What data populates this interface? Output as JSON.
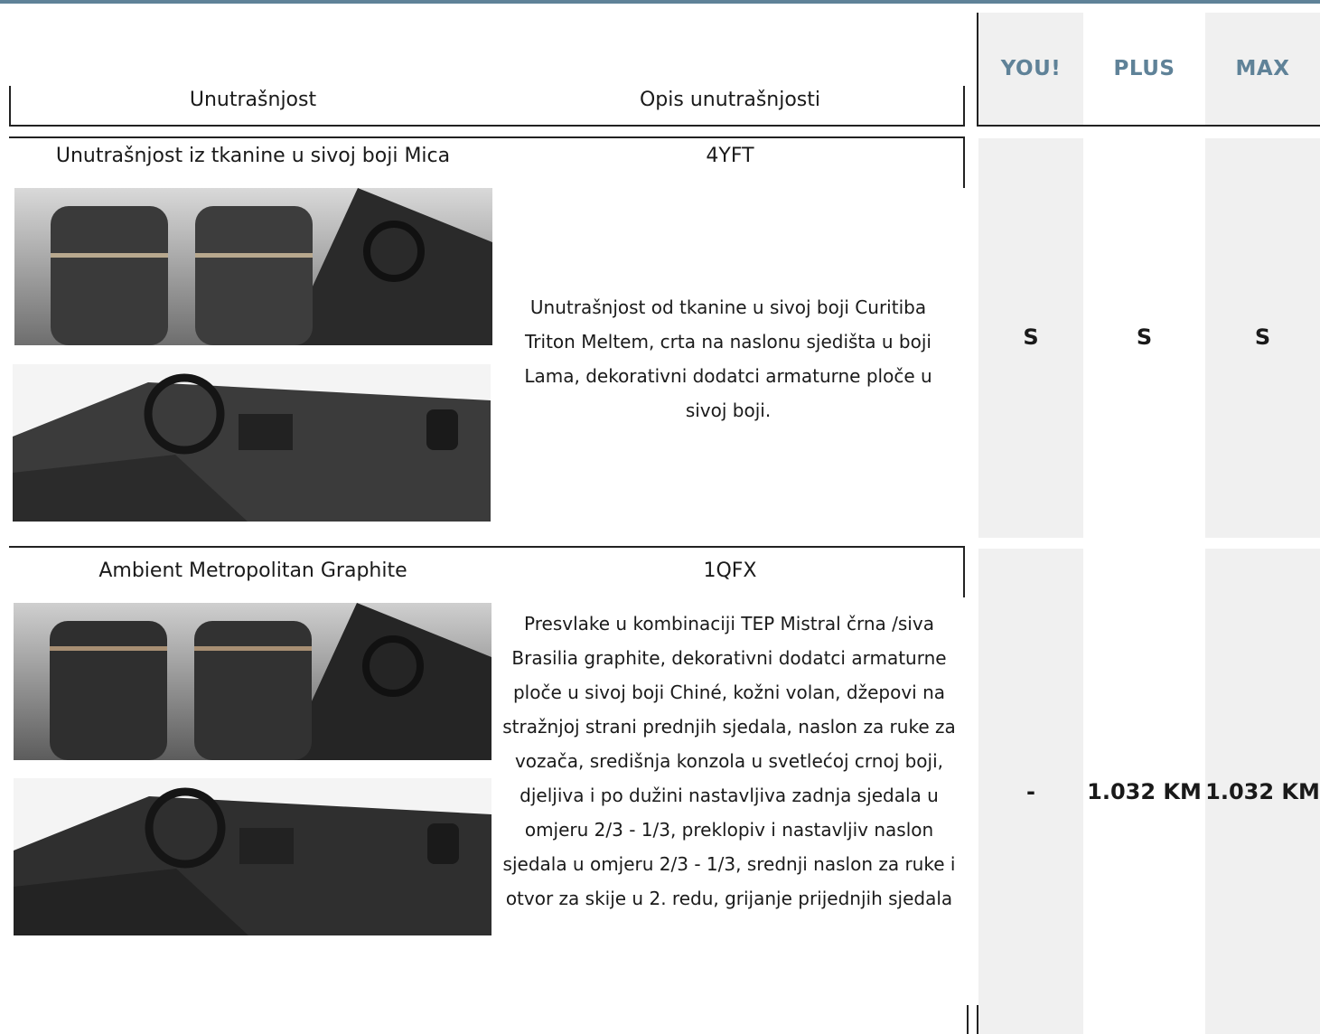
{
  "header": {
    "col_interior": "Unutrašnjost",
    "col_description": "Opis unutrašnjosti",
    "trims": [
      "YOU!",
      "PLUS",
      "MAX"
    ]
  },
  "rows": [
    {
      "name": "Unutrašnjost iz tkanine u sivoj boji Mica",
      "code": "4YFT",
      "description": "Unutrašnjost od tkanine u sivoj boji Curitiba Triton Meltem, crta na naslonu sjedišta u boji Lama, dekorativni dodatci armaturne ploče u sivoj boji.",
      "values": [
        "S",
        "S",
        "S"
      ],
      "images": [
        "rear-seats-photo",
        "dashboard-photo"
      ]
    },
    {
      "name": "Ambient Metropolitan Graphite",
      "code": "1QFX",
      "description": "Presvlake u kombinaciji  TEP Mistral črna /siva Brasilia graphite, dekorativni dodatci armaturne ploče u sivoj boji Chiné, kožni volan, džepovi na stražnjoj strani prednjih sjedala, naslon za ruke za vozača, središnja konzola u svetlećoj crnoj boji, djeljiva i po dužini nastavljiva zadnja sjedala u omjeru 2/3 - 1/3, preklopiv i nastavljiv naslon sjedala u omjeru 2/3 - 1/3, srednji naslon za ruke i otvor za skije u 2. redu, grijanje prijednjih sjedala",
      "values": [
        "-",
        "1.032 KM",
        "1.032 KM"
      ],
      "images": [
        "rear-seats-photo",
        "dashboard-photo"
      ]
    }
  ],
  "colors": {
    "accent": "#5f8298",
    "column_bg": "#f0f0f0",
    "line": "#222222"
  }
}
